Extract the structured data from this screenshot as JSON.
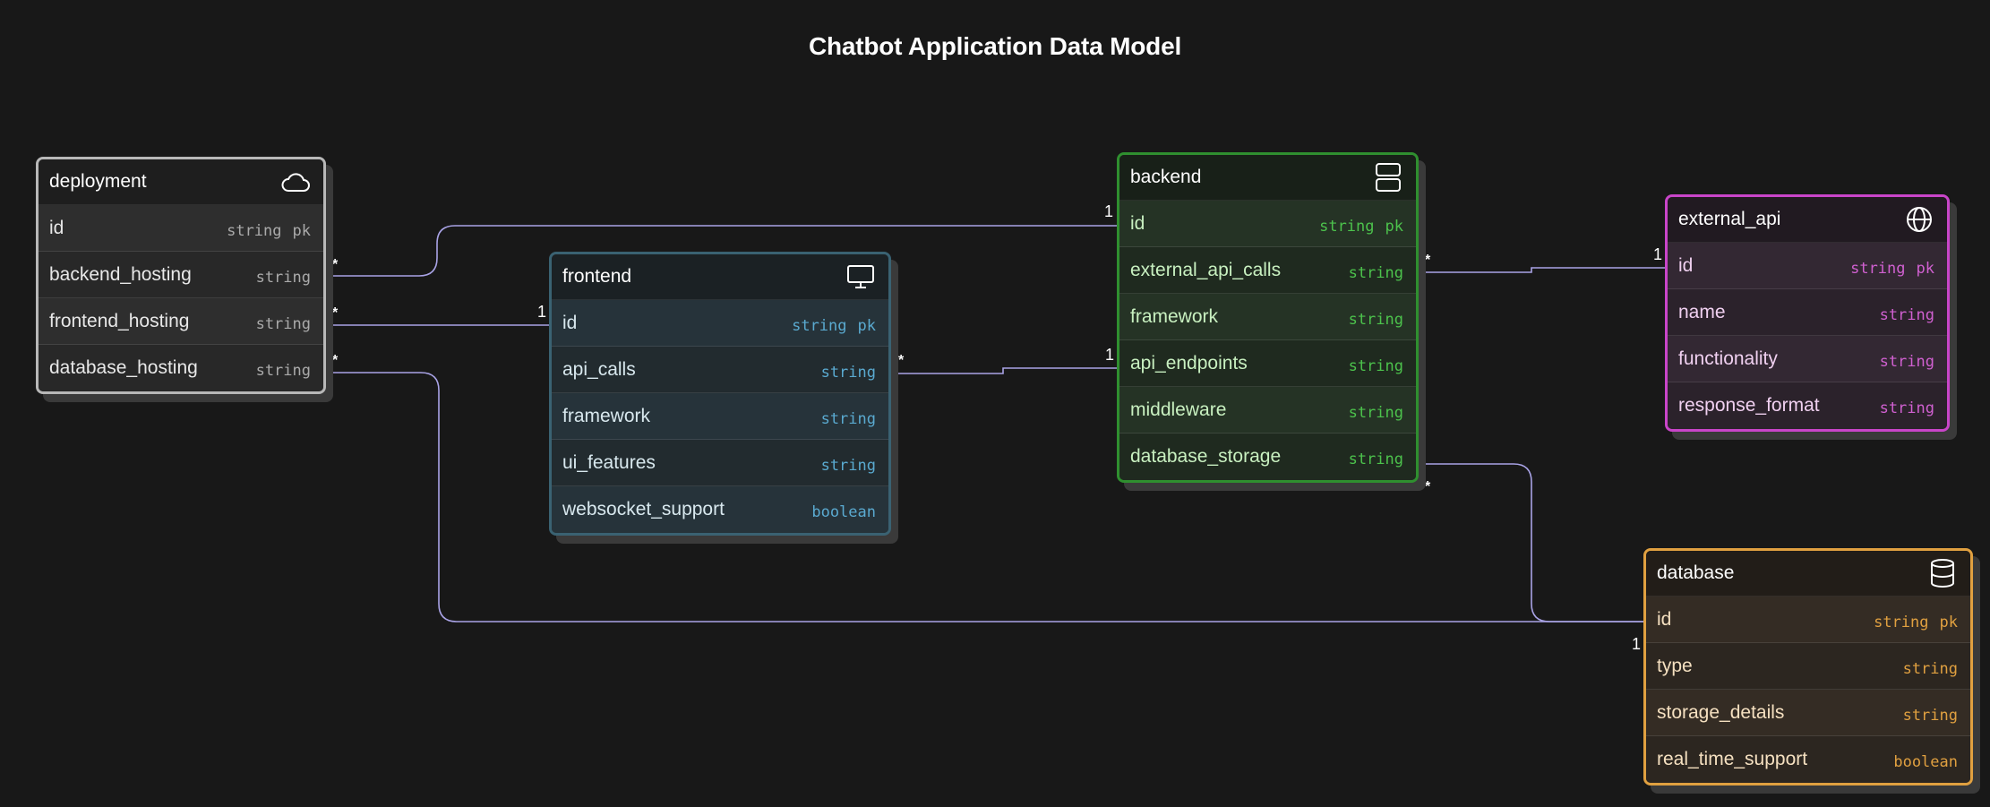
{
  "title": "Chatbot Application Data Model",
  "entities": {
    "deployment": {
      "name": "deployment",
      "icon": "cloud-icon",
      "color": "#b8b8b8",
      "fields": [
        {
          "name": "id",
          "type": "string",
          "key": "pk"
        },
        {
          "name": "backend_hosting",
          "type": "string"
        },
        {
          "name": "frontend_hosting",
          "type": "string"
        },
        {
          "name": "database_hosting",
          "type": "string"
        }
      ]
    },
    "frontend": {
      "name": "frontend",
      "icon": "monitor-icon",
      "color": "#3a6272",
      "fields": [
        {
          "name": "id",
          "type": "string",
          "key": "pk"
        },
        {
          "name": "api_calls",
          "type": "string"
        },
        {
          "name": "framework",
          "type": "string"
        },
        {
          "name": "ui_features",
          "type": "string"
        },
        {
          "name": "websocket_support",
          "type": "boolean"
        }
      ]
    },
    "backend": {
      "name": "backend",
      "icon": "server-icon",
      "color": "#2f8f2f",
      "fields": [
        {
          "name": "id",
          "type": "string",
          "key": "pk"
        },
        {
          "name": "external_api_calls",
          "type": "string"
        },
        {
          "name": "framework",
          "type": "string"
        },
        {
          "name": "api_endpoints",
          "type": "string"
        },
        {
          "name": "middleware",
          "type": "string"
        },
        {
          "name": "database_storage",
          "type": "string"
        }
      ]
    },
    "external_api": {
      "name": "external_api",
      "icon": "globe-icon",
      "color": "#c945c9",
      "fields": [
        {
          "name": "id",
          "type": "string",
          "key": "pk"
        },
        {
          "name": "name",
          "type": "string"
        },
        {
          "name": "functionality",
          "type": "string"
        },
        {
          "name": "response_format",
          "type": "string"
        }
      ]
    },
    "database": {
      "name": "database",
      "icon": "database-icon",
      "color": "#e0a040",
      "fields": [
        {
          "name": "id",
          "type": "string",
          "key": "pk"
        },
        {
          "name": "type",
          "type": "string"
        },
        {
          "name": "storage_details",
          "type": "string"
        },
        {
          "name": "real_time_support",
          "type": "boolean"
        }
      ]
    }
  },
  "relations": [
    {
      "from": "deployment.backend_hosting",
      "from_card": "*",
      "to": "backend.id",
      "to_card": "1"
    },
    {
      "from": "deployment.frontend_hosting",
      "from_card": "*",
      "to": "frontend.id",
      "to_card": "1"
    },
    {
      "from": "deployment.database_hosting",
      "from_card": "*",
      "to": "database.id",
      "to_card": "1"
    },
    {
      "from": "frontend.api_calls",
      "from_card": "*",
      "to": "backend.api_endpoints",
      "to_card": "1"
    },
    {
      "from": "backend.external_api_calls",
      "from_card": "*",
      "to": "external_api.id",
      "to_card": "1"
    },
    {
      "from": "backend.database_storage",
      "from_card": "*",
      "to": "database.id",
      "to_card": "1"
    }
  ]
}
